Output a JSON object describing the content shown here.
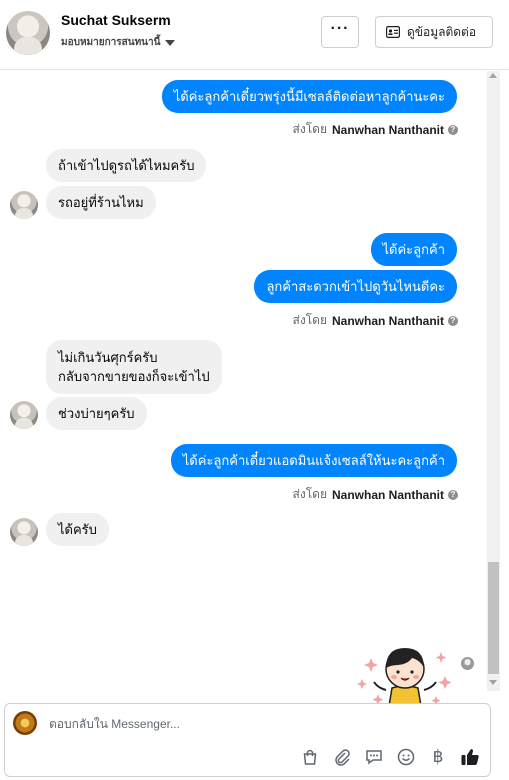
{
  "header": {
    "contact_name": "Suchat Sukserm",
    "assign_label": "มอบหมายการสนทนานี้",
    "more_label": "···",
    "contact_info_label": "ดูข้อมูลติดต่อ"
  },
  "messages": [
    {
      "dir": "out",
      "text": "ได้ค่ะลูกค้าเดี๋ยวพรุ่งนี้มีเซลล์ติดต่อหาลูกค้านะคะ"
    },
    {
      "dir": "meta",
      "prefix": "ส่งโดย",
      "sender": "Nanwhan Nanthanit"
    },
    {
      "dir": "in",
      "text": "ถ้าเข้าไปดูรถได้ไหมครับ"
    },
    {
      "dir": "in",
      "text": "รถอยู่ที่ร้านไหม"
    },
    {
      "dir": "out",
      "text": "ได้ค่ะลูกค้า"
    },
    {
      "dir": "out",
      "text": "ลูกค้าสะดวกเข้าไปดูวันไหนดีคะ"
    },
    {
      "dir": "meta",
      "prefix": "ส่งโดย",
      "sender": "Nanwhan Nanthanit"
    },
    {
      "dir": "in",
      "text": "ไม่เกินวันศุกร์ครับ",
      "text2": "กลับจากขายของก็จะเข้าไป"
    },
    {
      "dir": "in",
      "text": "ช่วงบ่ายๆครับ"
    },
    {
      "dir": "out",
      "text": "ได้ค่ะลูกค้าเดี๋ยวแอดมินแจ้งเซลล์ให้นะคะลูกค้า"
    },
    {
      "dir": "meta",
      "prefix": "ส่งโดย",
      "sender": "Nanwhan Nanthanit"
    },
    {
      "dir": "in",
      "text": "ได้ครับ"
    }
  ],
  "composer": {
    "placeholder": "ตอบกลับใน Messenger...",
    "tool_icons": [
      "shopping-bag-icon",
      "paperclip-icon",
      "saved-reply-icon",
      "emoji-icon",
      "baht-icon",
      "thumbs-up-icon"
    ],
    "baht_symbol": "฿"
  },
  "colors": {
    "outgoing_bubble": "#0084ff",
    "incoming_bubble": "#f0f0f0",
    "like_button": "#1c1e21"
  }
}
